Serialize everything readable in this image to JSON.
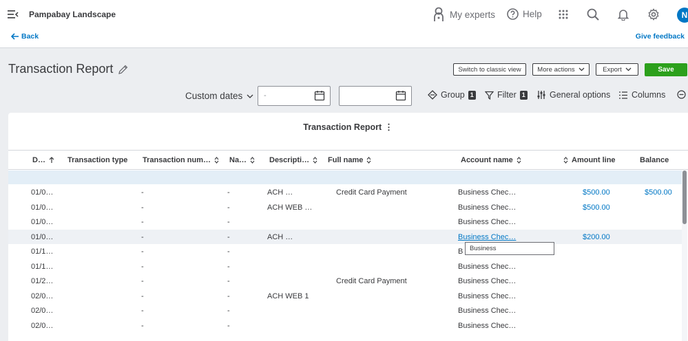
{
  "topbar": {
    "company": "Pampabay Landscape",
    "my_experts": "My experts",
    "help": "Help",
    "avatar_initial": "N"
  },
  "nav": {
    "back": "Back",
    "give_feedback": "Give feedback"
  },
  "page": {
    "title": "Transaction Report"
  },
  "actions": {
    "switch": "Switch to classic view",
    "more": "More actions",
    "export": "Export",
    "save": "Save"
  },
  "filters": {
    "date_range": "Custom dates",
    "group_label": "Group",
    "group_count": "1",
    "filter_label": "Filter",
    "filter_count": "1",
    "general_options": "General options",
    "columns": "Columns"
  },
  "report": {
    "title": "Transaction Report",
    "columns": [
      "D…",
      "Transaction type",
      "Transaction num…",
      "Na…",
      "Descripti…",
      "Full name",
      "Account name",
      "Amount line",
      "Balance"
    ],
    "rows": [
      {
        "date": "01/0…",
        "num": "-",
        "name": "-",
        "desc": "ACH …",
        "full_name": "Credit Card Payment",
        "account": "Business Chec…",
        "amount": "$500.00",
        "balance": "$500.00"
      },
      {
        "date": "01/0…",
        "num": "-",
        "name": "-",
        "desc": "ACH WEB …",
        "full_name": "",
        "account": "Business Chec…",
        "amount": "$500.00",
        "balance": ""
      },
      {
        "date": "01/0…",
        "num": "-",
        "name": "-",
        "desc": "",
        "full_name": "",
        "account": "Business Chec…",
        "amount": "",
        "balance": ""
      },
      {
        "date": "01/0…",
        "num": "-",
        "name": "-",
        "desc": "ACH …",
        "full_name": "",
        "account": "Business Chec…",
        "amount": "$200.00",
        "balance": ""
      },
      {
        "date": "01/1…",
        "num": "-",
        "name": "-",
        "desc": "",
        "full_name": "",
        "account": "B",
        "amount": "",
        "balance": ""
      },
      {
        "date": "01/1…",
        "num": "-",
        "name": "-",
        "desc": "",
        "full_name": "",
        "account": "Business Chec…",
        "amount": "",
        "balance": ""
      },
      {
        "date": "01/2…",
        "num": "-",
        "name": "-",
        "desc": "",
        "full_name": "Credit Card Payment",
        "account": "Business Chec…",
        "amount": "",
        "balance": ""
      },
      {
        "date": "02/0…",
        "num": "-",
        "name": "-",
        "desc": "ACH WEB 1",
        "full_name": "",
        "account": "Business Chec…",
        "amount": "",
        "balance": ""
      },
      {
        "date": "02/0…",
        "num": "-",
        "name": "-",
        "desc": "",
        "full_name": "",
        "account": "Business Chec…",
        "amount": "",
        "balance": ""
      },
      {
        "date": "02/0…",
        "num": "-",
        "name": "-",
        "desc": "",
        "full_name": "",
        "account": "Business Chec…",
        "amount": "",
        "balance": ""
      }
    ],
    "tooltip": "Business"
  }
}
